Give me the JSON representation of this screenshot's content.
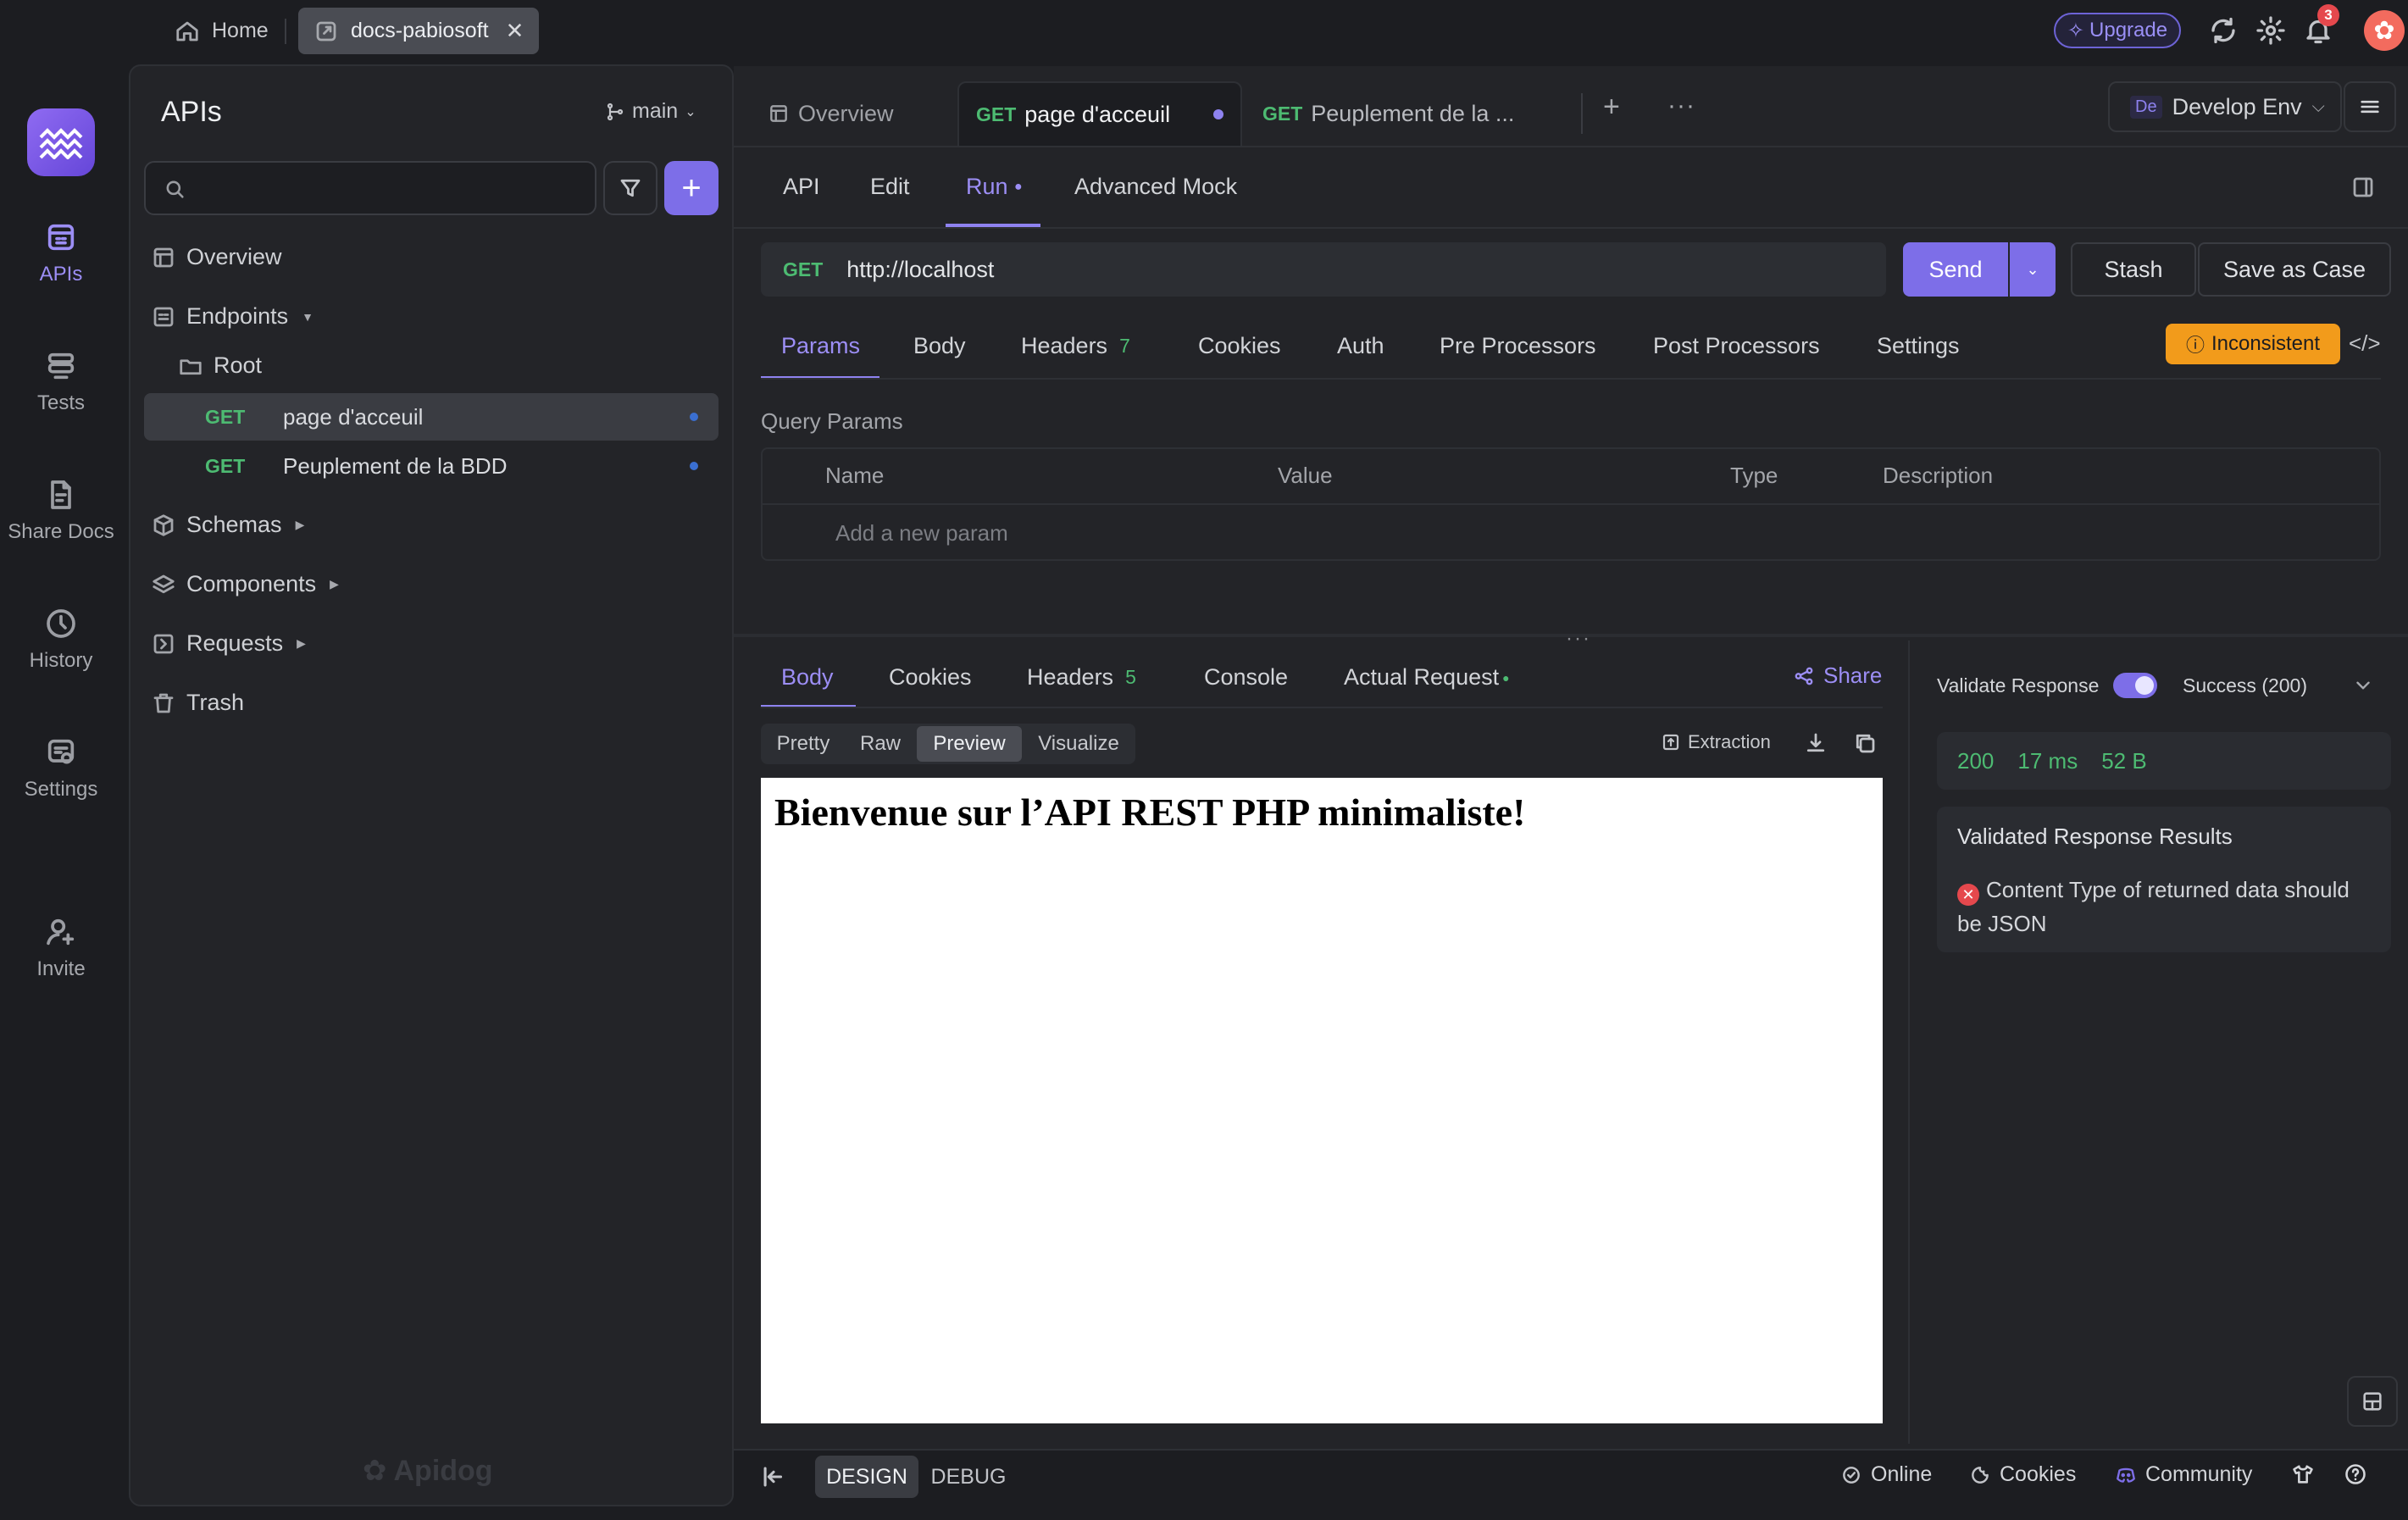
{
  "top_tabs": {
    "home": "Home",
    "docs": "docs-pabiosoft",
    "close": "✕"
  },
  "upgrade": "Upgrade",
  "notifications_count": "3",
  "rail": {
    "apis": "APIs",
    "tests": "Tests",
    "share_docs": "Share Docs",
    "history": "History",
    "settings": "Settings",
    "invite": "Invite"
  },
  "sidebar": {
    "title": "APIs",
    "branch": "main",
    "search_placeholder": "",
    "tree": {
      "overview": "Overview",
      "endpoints": "Endpoints",
      "root": "Root",
      "endpoint_items": [
        {
          "method": "GET",
          "label": "page d'acceuil"
        },
        {
          "method": "GET",
          "label": "Peuplement de la BDD"
        }
      ],
      "schemas": "Schemas",
      "components": "Components",
      "requests": "Requests",
      "trash": "Trash"
    },
    "watermark": "Apidog"
  },
  "doc_tabs": {
    "overview": "Overview",
    "tab1": {
      "method": "GET",
      "label": "page d'acceuil"
    },
    "tab2": {
      "method": "GET",
      "label": "Peuplement de la ..."
    }
  },
  "env": {
    "badge": "De",
    "label": "Develop Env"
  },
  "sub_tabs": {
    "api": "API",
    "edit": "Edit",
    "run": "Run",
    "advanced_mock": "Advanced Mock"
  },
  "request": {
    "method": "GET",
    "url": "http://localhost",
    "send": "Send",
    "stash": "Stash",
    "save_as_case": "Save as Case"
  },
  "param_tabs": {
    "params": "Params",
    "body": "Body",
    "headers": "Headers",
    "headers_count": "7",
    "cookies": "Cookies",
    "auth": "Auth",
    "pre_processors": "Pre Processors",
    "post_processors": "Post Processors",
    "settings": "Settings",
    "inconsistent": "Inconsistent"
  },
  "query_params": {
    "label": "Query Params",
    "columns": [
      "Name",
      "Value",
      "Type",
      "Description"
    ],
    "add_placeholder": "Add a new param"
  },
  "response_tabs": {
    "body": "Body",
    "cookies": "Cookies",
    "headers": "Headers",
    "headers_count": "5",
    "console": "Console",
    "actual_request": "Actual Request",
    "share": "Share"
  },
  "view_modes": {
    "pretty": "Pretty",
    "raw": "Raw",
    "preview": "Preview",
    "visualize": "Visualize",
    "extraction": "Extraction"
  },
  "preview_heading": "Bienvenue sur l’API REST PHP minimaliste!",
  "validation": {
    "label": "Validate Response",
    "status": "Success (200)",
    "code": "200",
    "time": "17 ms",
    "size": "52 B",
    "results_title": "Validated Response Results",
    "error": "Content Type of returned data should be JSON"
  },
  "bottom": {
    "design": "DESIGN",
    "debug": "DEBUG",
    "online": "Online",
    "cookies": "Cookies",
    "community": "Community"
  },
  "colors": {
    "accent": "#7d6ee8",
    "get": "#4dbb72",
    "warning": "#f29b1b",
    "error": "#e5484d"
  }
}
